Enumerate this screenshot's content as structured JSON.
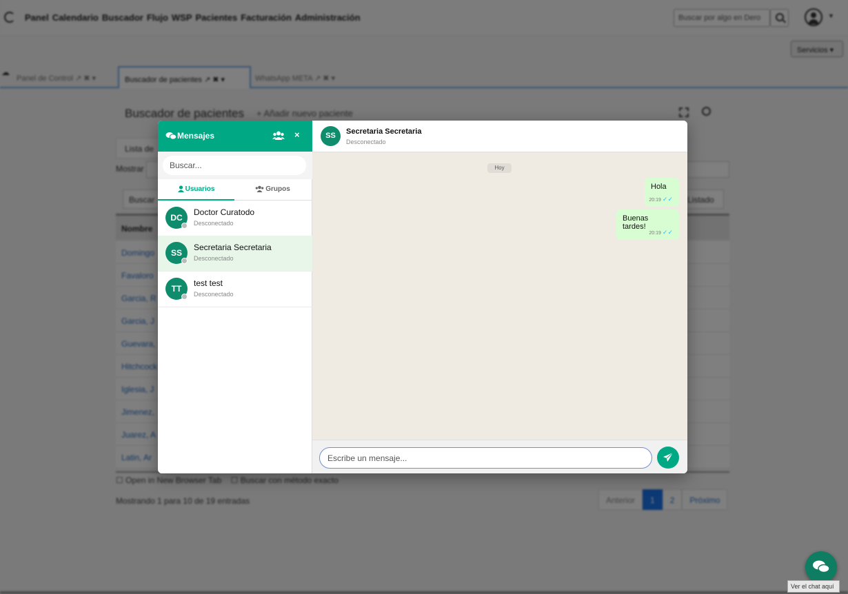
{
  "nav": {
    "links": [
      "Panel",
      "Calendario",
      "Buscador",
      "Flujo",
      "WSP",
      "Pacientes",
      "Facturación",
      "Administración"
    ],
    "search_placeholder": "Buscar por algo en Dero",
    "services_label": "Servicios ▾"
  },
  "tabs": [
    {
      "label": "Panel de Control ↗ ✖ ▾"
    },
    {
      "label": "Buscador de pacientes ↗ ✖ ▾"
    },
    {
      "label": "WhatsApp META ↗ ✖ ▾"
    }
  ],
  "panel": {
    "title": "Buscador de pacientes",
    "add_label": "+ Añadir nuevo paciente",
    "list_tab": "Lista de",
    "show_label": "Mostrar",
    "search_label": "Buscar",
    "list_btn": "Listado",
    "col_name": "Nombre",
    "rows": [
      "Domingo",
      "Favaloro",
      "Garcia, R",
      "Garcia, J",
      "Guevara,",
      "Hitchcock",
      "Iglesia, J",
      "Jimenez,",
      "Juarez, A",
      "Latin, Ar"
    ],
    "option_new_tab": "☐ Open in New Browser Tab",
    "option_exact": "☐ Buscar con método exacto",
    "showing": "Mostrando 1 para 10 de 19 entradas",
    "pager": {
      "prev": "Anterior",
      "p1": "1",
      "p2": "2",
      "next": "Próximo"
    }
  },
  "fab_tag": "Ver el chat aquí",
  "messages_panel": {
    "title": "Mensajes",
    "close": "×",
    "search_placeholder": "Buscar...",
    "tab_users": "Usuarios",
    "tab_groups": "Grupos",
    "contacts": [
      {
        "initials": "DC",
        "name": "Doctor Curatodo",
        "status": "Desconectado"
      },
      {
        "initials": "SS",
        "name": "Secretaria Secretaria",
        "status": "Desconectado"
      },
      {
        "initials": "TT",
        "name": "test test",
        "status": "Desconectado"
      }
    ]
  },
  "chat": {
    "contact_initials": "SS",
    "contact_name": "Secretaria Secretaria",
    "contact_status": "Desconectado",
    "day": "Hoy",
    "messages": [
      {
        "text": "Hola",
        "time": "20:19"
      },
      {
        "text": "Buenas tardes!",
        "time": "20:19"
      }
    ],
    "input_placeholder": "Escribe un mensaje..."
  },
  "colors": {
    "accent": "#00a884",
    "avatar": "#0e8c6c",
    "bubble": "#d9fdd3",
    "chat_bg": "#efeae2"
  }
}
